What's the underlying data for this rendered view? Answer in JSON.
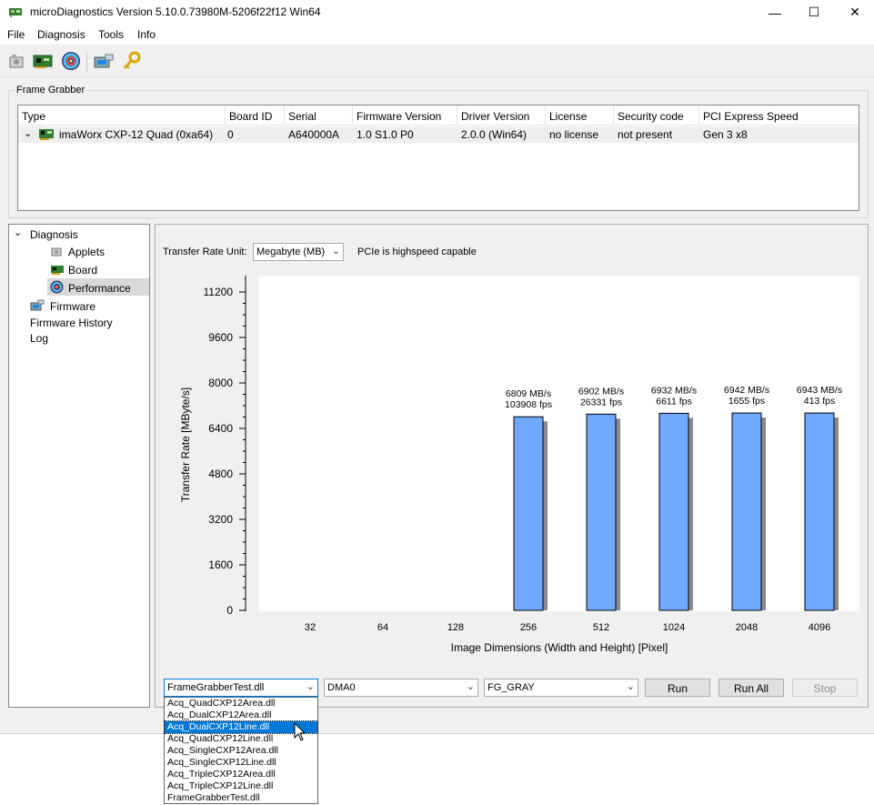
{
  "window": {
    "title": "microDiagnostics Version 5.10.0.73980M-5206f22f12 Win64",
    "controls": {
      "minimize": "—",
      "maximize": "☐",
      "close": "✕"
    }
  },
  "menu": [
    "File",
    "Diagnosis",
    "Tools",
    "Info"
  ],
  "toolbar": {
    "icons": [
      "applet-icon",
      "board-icon",
      "performance-icon",
      "firmware-icon",
      "license-key-icon"
    ]
  },
  "frame_grabber": {
    "group_label": "Frame Grabber",
    "columns": [
      "Type",
      "Board ID",
      "Serial",
      "Firmware Version",
      "Driver Version",
      "License",
      "Security code",
      "PCI Express Speed"
    ],
    "rows": [
      {
        "type": "imaWorx CXP-12 Quad (0xa64)",
        "board_id": "0",
        "serial": "A640000A",
        "firmware": "1.0 S1.0 P0",
        "driver": "2.0.0 (Win64)",
        "license": "no license",
        "security": "not present",
        "pcie": "Gen 3 x8"
      }
    ]
  },
  "tree": {
    "root": "Diagnosis",
    "children": [
      "Applets",
      "Board",
      "Performance"
    ],
    "others": [
      "Firmware",
      "Firmware History",
      "Log"
    ],
    "selected": "Performance"
  },
  "performance": {
    "unit_label": "Transfer Rate Unit:",
    "unit_value": "Megabyte (MB)",
    "pcie_status": "PCIe is highspeed capable",
    "applet_combo": "FrameGrabberTest.dll",
    "dma_combo": "DMA0",
    "format_combo": "FG_GRAY",
    "run_label": "Run",
    "run_all_label": "Run All",
    "stop_label": "Stop"
  },
  "chart_data": {
    "type": "bar",
    "xlabel": "Image Dimensions (Width and Height) [Pixel]",
    "ylabel": "Transfer Rate [MByte/s]",
    "ylim": [
      0,
      11200
    ],
    "yticks": [
      0,
      1600,
      3200,
      4800,
      6400,
      8000,
      9600,
      11200
    ],
    "categories": [
      "32",
      "64",
      "128",
      "256",
      "512",
      "1024",
      "2048",
      "4096"
    ],
    "values": [
      null,
      null,
      null,
      6809,
      6902,
      6932,
      6942,
      6943
    ],
    "labels_rate": [
      "",
      "",
      "",
      "6809 MB/s",
      "6902 MB/s",
      "6932 MB/s",
      "6942 MB/s",
      "6943 MB/s"
    ],
    "labels_fps": [
      "",
      "",
      "",
      "103908 fps",
      "26331 fps",
      "6611 fps",
      "1655 fps",
      "413 fps"
    ],
    "bar_color": "#6fa8ff",
    "grid": false
  },
  "dropdown": {
    "options": [
      "Acq_QuadCXP12Area.dll",
      "Acq_DualCXP12Area.dll",
      "Acq_DualCXP12Line.dll",
      "Acq_QuadCXP12Line.dll",
      "Acq_SingleCXP12Area.dll",
      "Acq_SingleCXP12Line.dll",
      "Acq_TripleCXP12Area.dll",
      "Acq_TripleCXP12Line.dll",
      "FrameGrabberTest.dll"
    ],
    "highlighted": "Acq_DualCXP12Line.dll"
  }
}
